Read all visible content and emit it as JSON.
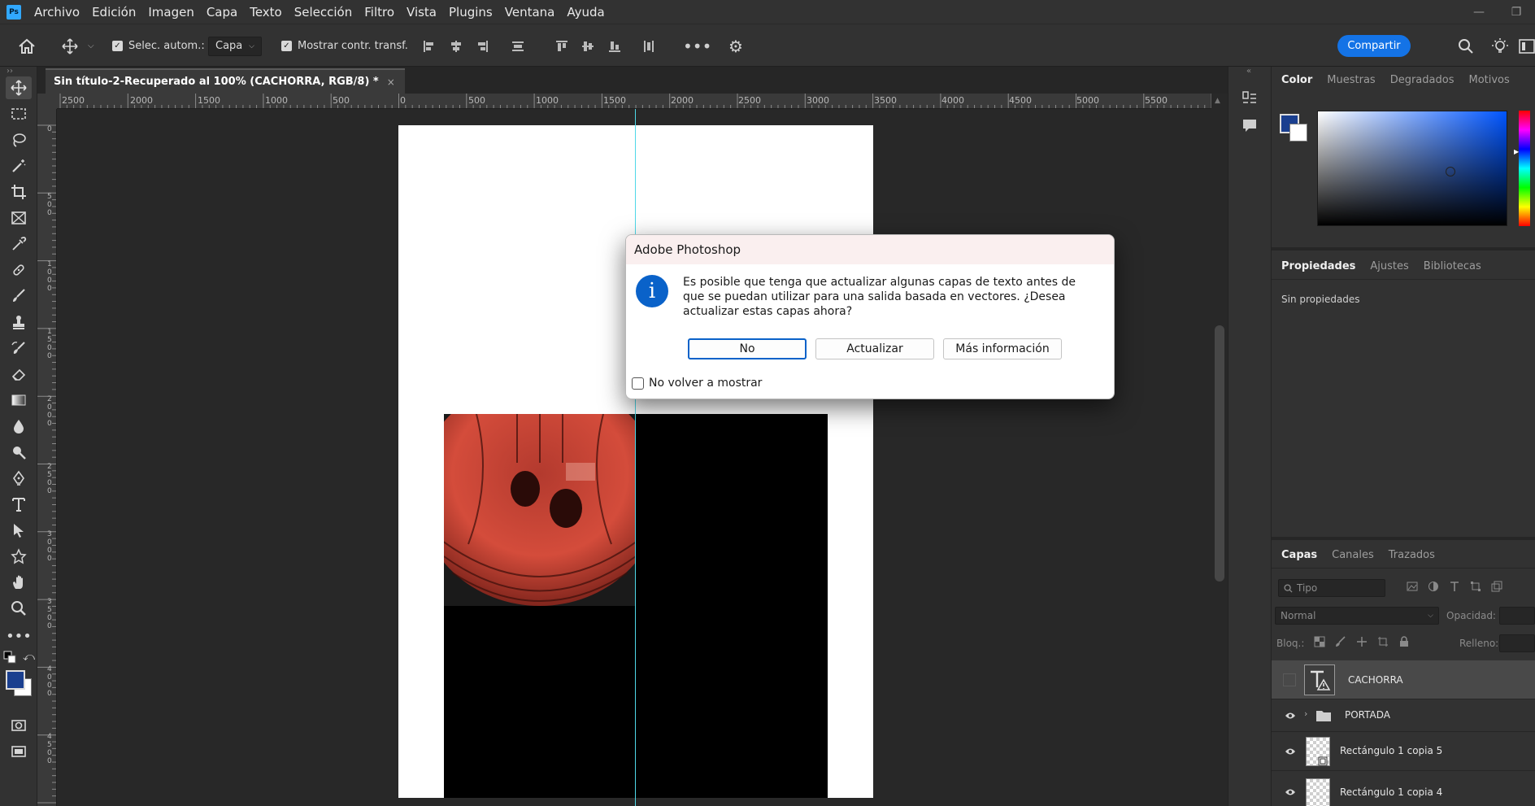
{
  "app": {
    "logo": "Ps"
  },
  "menu": [
    "Archivo",
    "Edición",
    "Imagen",
    "Capa",
    "Texto",
    "Selección",
    "Filtro",
    "Vista",
    "Plugins",
    "Ventana",
    "Ayuda"
  ],
  "options": {
    "auto_select_label": "Selec. autom.:",
    "auto_select_value": "Capa",
    "show_transform_label": "Mostrar contr. transf.",
    "share_label": "Compartir"
  },
  "document": {
    "tab_title": "Sin título-2-Recuperado al 100% (CACHORRA, RGB/8) *",
    "close_glyph": "×"
  },
  "ruler": {
    "h_labels": [
      "2500",
      "2000",
      "1500",
      "1000",
      "500",
      "0",
      "500",
      "1000",
      "1500",
      "2000",
      "2500",
      "3000",
      "3500",
      "4000",
      "4500",
      "5000",
      "5500"
    ],
    "v_labels": [
      "0",
      "500",
      "1000",
      "1500",
      "2000",
      "2500",
      "3000",
      "3500",
      "4000",
      "4500"
    ]
  },
  "panels": {
    "color_tabs": [
      "Color",
      "Muestras",
      "Degradados",
      "Motivos"
    ],
    "colors": {
      "foreground": "#1a3f8f",
      "background": "#ffffff"
    },
    "properties_tabs": [
      "Propiedades",
      "Ajustes",
      "Bibliotecas"
    ],
    "properties_empty": "Sin propiedades",
    "layers_tabs": [
      "Capas",
      "Canales",
      "Trazados"
    ],
    "layers_search_placeholder": "Tipo",
    "blend_mode": "Normal",
    "opacity_label": "Opacidad:",
    "lock_label": "Bloq.:",
    "fill_label": "Relleno:",
    "layers": [
      {
        "name": "CACHORRA",
        "type": "text",
        "visible": false,
        "selected": true
      },
      {
        "name": "PORTADA",
        "type": "group",
        "visible": true,
        "selected": false
      },
      {
        "name": "Rectángulo 1 copia 5",
        "type": "shape",
        "visible": true,
        "selected": false
      },
      {
        "name": "Rectángulo 1 copia 4",
        "type": "shape",
        "visible": true,
        "selected": false
      }
    ]
  },
  "dialog": {
    "title": "Adobe Photoshop",
    "icon_glyph": "i",
    "message": "Es posible que tenga que actualizar algunas capas de texto antes de que se puedan utilizar para una salida basada en vectores. ¿Desea actualizar estas capas ahora?",
    "buttons": {
      "no": "No",
      "update": "Actualizar",
      "more_info": "Más información"
    },
    "dont_show_label": "No volver a mostrar",
    "dont_show_checked": false
  }
}
